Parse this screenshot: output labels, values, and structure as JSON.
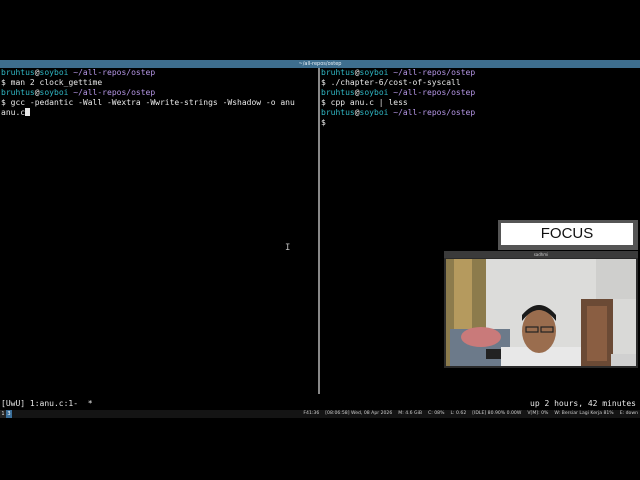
{
  "window": {
    "title": "~/all-repos/ostep"
  },
  "terminal_left": {
    "lines": [
      {
        "user": "bruhtus",
        "host": "soyboi",
        "path": "~/all-repos/ostep"
      },
      {
        "prompt": "$",
        "command": " man 2 clock_gettime"
      },
      {
        "user": "bruhtus",
        "host": "soyboi",
        "path": "~/all-repos/ostep"
      },
      {
        "prompt": "$",
        "command": " gcc -pedantic -Wall -Wextra -Wwrite-strings -Wshadow -o anu"
      },
      {
        "text": "anu.c"
      }
    ]
  },
  "terminal_right": {
    "lines": [
      {
        "user": "bruhtus",
        "host": "soyboi",
        "path": "~/all-repos/ostep"
      },
      {
        "prompt": "$",
        "command": " ./chapter-6/cost-of-syscall"
      },
      {
        "user": "bruhtus",
        "host": "soyboi",
        "path": "~/all-repos/ostep"
      },
      {
        "prompt": "$",
        "command": " cpp anu.c | less"
      },
      {
        "user": "bruhtus",
        "host": "soyboi",
        "path": "~/all-repos/ostep"
      },
      {
        "prompt": "$",
        "command": ""
      }
    ]
  },
  "overlay": {
    "focus_label": "FOCUS",
    "webcam_title": "sadhmi"
  },
  "tmux_status": {
    "left": "[UwU] 1:anu.c:1-  *",
    "right": "up 2 hours, 42 minutes"
  },
  "wm_bar": {
    "workspaces": [
      "1",
      "3"
    ],
    "status_items": [
      "F41:36",
      "[08:06:58] Wed, 08 Apr 2026",
      "M: 4.6 GiB",
      "C: 08%",
      "L: 0.62",
      "[IDLE] 80.90% 0.00W",
      "V[M]: 0%",
      "W: Bersiar Lagi Kerja  81%",
      "E: down"
    ]
  },
  "colors": {
    "user_host": "#2fb7c4",
    "path": "#b596e6",
    "titlebar": "#3e6e8e"
  }
}
